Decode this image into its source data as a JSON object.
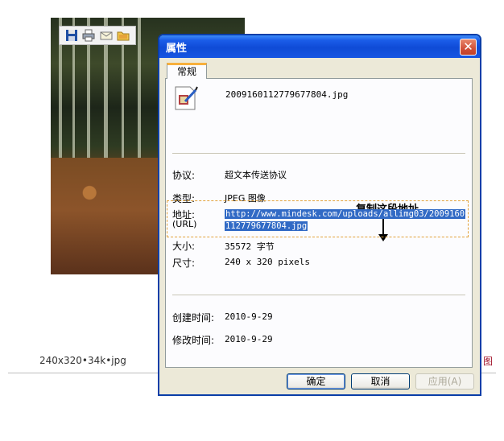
{
  "page": {
    "caption": "240x320•34k•jpg",
    "side_link": "图"
  },
  "dialog": {
    "title": "属性",
    "close_glyph": "✕",
    "tab_label": "常规",
    "filename": "2009160112779677804.jpg",
    "rows": {
      "protocol_label": "协议:",
      "protocol_value": "超文本传送协议",
      "type_label": "类型:",
      "type_value": "JPEG 图像",
      "address_label": "地址:",
      "address_sublabel": "(URL)",
      "address_line1": "http://www.mindesk.com/uploads/allimg03/2009160",
      "address_line2": "112779677804.jpg",
      "size_label": "大小:",
      "size_value": "35572 字节",
      "dims_label": "尺寸:",
      "dims_value": "240  x  320  pixels",
      "created_label": "创建时间:",
      "created_value": "2010-9-29",
      "modified_label": "修改时间:",
      "modified_value": "2010-9-29"
    },
    "annotation": "复制这段地址",
    "buttons": {
      "ok": "确定",
      "cancel": "取消",
      "apply": "应用(A)"
    }
  },
  "icons": {
    "toolbar": [
      "save-icon",
      "print-icon",
      "mail-icon",
      "folder-icon"
    ],
    "file": "image-file-icon"
  }
}
